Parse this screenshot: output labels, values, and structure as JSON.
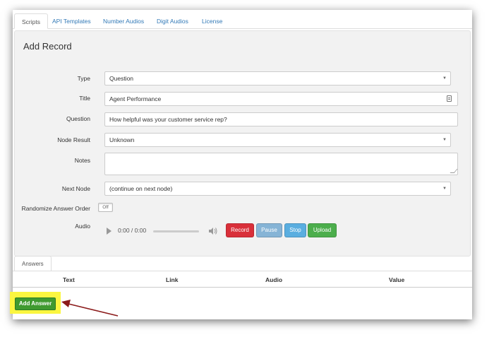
{
  "tabs": [
    {
      "label": "Scripts",
      "active": true
    },
    {
      "label": "API Templates"
    },
    {
      "label": "Number Audios"
    },
    {
      "label": "Digit Audios"
    },
    {
      "label": "License"
    }
  ],
  "form": {
    "title": "Add Record",
    "type": {
      "label": "Type",
      "value": "Question"
    },
    "title_field": {
      "label": "Title",
      "value": "Agent Performance"
    },
    "question": {
      "label": "Question",
      "value": "How helpful was your customer service rep?"
    },
    "node_result": {
      "label": "Node Result",
      "value": "Unknown"
    },
    "notes": {
      "label": "Notes",
      "value": ""
    },
    "next_node": {
      "label": "Next Node",
      "value": "(continue on next node)"
    },
    "randomize": {
      "label": "Randomize Answer Order",
      "state": "Off"
    },
    "audio": {
      "label": "Audio",
      "time": "0:00 / 0:00",
      "record_label": "Record",
      "pause_label": "Pause",
      "stop_label": "Stop",
      "upload_label": "Upload"
    }
  },
  "answers": {
    "tab_label": "Answers",
    "columns": [
      "Text",
      "Link",
      "Audio",
      "Value"
    ],
    "add_label": "Add Answer"
  },
  "colors": {
    "link": "#337ab7",
    "record": "#d9303a",
    "pause": "#86b4d6",
    "stop": "#5aaee0",
    "upload": "#4cae4c",
    "add_answer": "#3f9a2f",
    "highlight": "#fbf640",
    "arrow": "#8b1a1a"
  }
}
